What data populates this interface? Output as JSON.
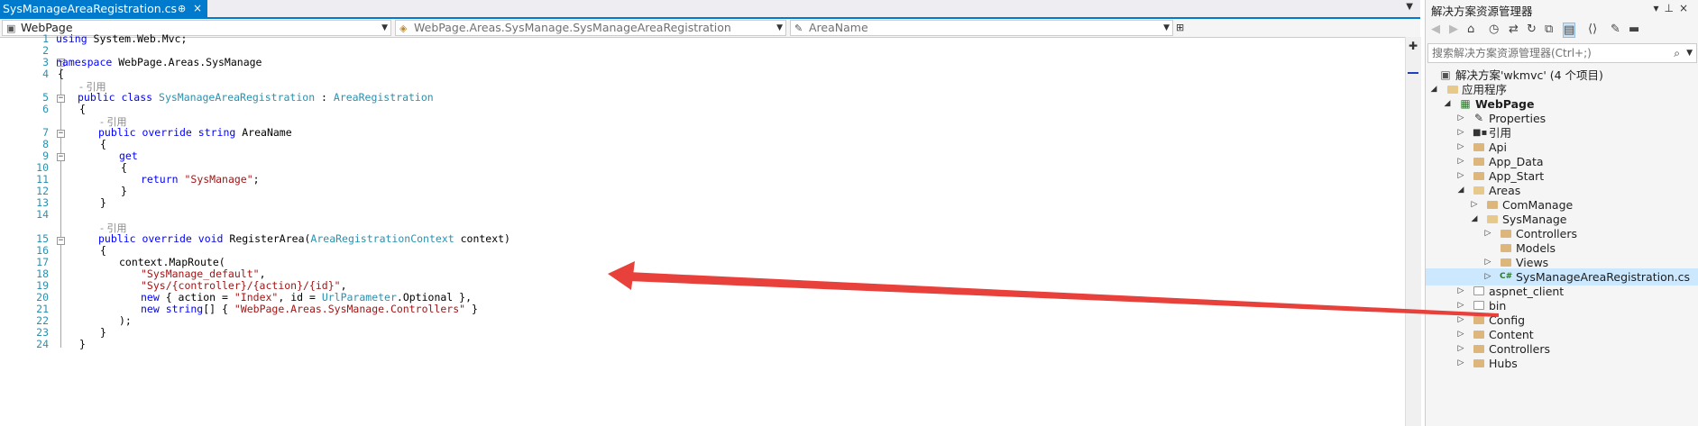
{
  "editor": {
    "tab_title": "SysManageAreaRegistration.cs",
    "pin_glyph": "⊕",
    "close_glyph": "×",
    "project_combo": "WebPage",
    "class_combo": "WebPage.Areas.SysManage.SysManageAreaRegistration",
    "member_combo": "AreaName",
    "references_hint": "- 引用",
    "line_numbers": [
      "1",
      "2",
      "3",
      "4",
      "5",
      "6",
      "7",
      "8",
      "9",
      "10",
      "11",
      "12",
      "13",
      "14",
      "15",
      "16",
      "17",
      "18",
      "19",
      "20",
      "21",
      "22",
      "23",
      "24"
    ],
    "code": {
      "l1_kw": "using",
      "l1_rest": " System.Web.Mvc;",
      "l3_kw": "namespace",
      "l3_rest": " WebPage.Areas.SysManage",
      "l4": "{",
      "l5_kw": "public class",
      "l5_type": "SysManageAreaRegistration",
      "l5_sep": " : ",
      "l5_base": "AreaRegistration",
      "l6": "{",
      "l7_kw": "public override string",
      "l7_rest": " AreaName",
      "l8": "{",
      "l9_kw": "get",
      "l10": "{",
      "l11_kw": "return",
      "l11_str": "\"SysManage\"",
      "l11_end": ";",
      "l12": "}",
      "l13": "}",
      "l15_kw": "public override void",
      "l15_name": " RegisterArea(",
      "l15_type": "AreaRegistrationContext",
      "l15_end": " context)",
      "l16": "{",
      "l17": "context.MapRoute(",
      "l18_str": "\"SysManage_default\"",
      "l18_end": ",",
      "l19_str": "\"Sys/{controller}/{action}/{id}\"",
      "l19_end": ",",
      "l20_kw": "new",
      "l20_a": " { action = ",
      "l20_str": "\"Index\"",
      "l20_b": ", id = ",
      "l20_type": "UrlParameter",
      "l20_c": ".Optional },",
      "l21_kw": "new string",
      "l21_a": "[] { ",
      "l21_str": "\"WebPage.Areas.SysManage.Controllers\"",
      "l21_b": " }",
      "l22": ");",
      "l23": "}",
      "l24": "}"
    }
  },
  "explorer": {
    "title": "解决方案资源管理器",
    "search_placeholder": "搜索解决方案资源管理器(Ctrl+;)",
    "items": [
      {
        "label": "解决方案'wkmvc' (4 个项目)"
      },
      {
        "label": "应用程序"
      },
      {
        "label": "WebPage"
      },
      {
        "label": "Properties"
      },
      {
        "label": "引用"
      },
      {
        "label": "Api"
      },
      {
        "label": "App_Data"
      },
      {
        "label": "App_Start"
      },
      {
        "label": "Areas"
      },
      {
        "label": "ComManage"
      },
      {
        "label": "SysManage"
      },
      {
        "label": "Controllers"
      },
      {
        "label": "Models"
      },
      {
        "label": "Views"
      },
      {
        "label": "SysManageAreaRegistration.cs"
      },
      {
        "label": "aspnet_client"
      },
      {
        "label": "bin"
      },
      {
        "label": "Config"
      },
      {
        "label": "Content"
      },
      {
        "label": "Controllers"
      },
      {
        "label": "Hubs"
      }
    ]
  },
  "colors": {
    "accent": "#007acc",
    "keyword": "#0000ff",
    "type": "#2b91af",
    "string": "#a31515",
    "arrow": "#e8403a",
    "selection": "#cce8ff"
  }
}
